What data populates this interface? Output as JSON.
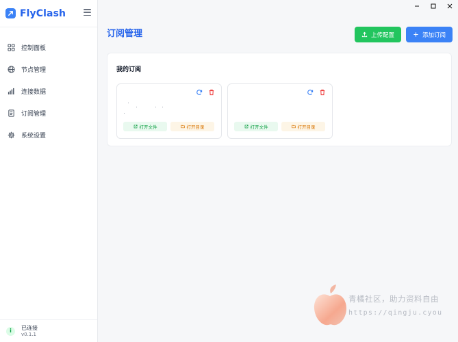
{
  "app": {
    "name": "FlyClash"
  },
  "sidebar": {
    "items": [
      {
        "label": "控制面板",
        "icon": "dashboard-icon"
      },
      {
        "label": "节点管理",
        "icon": "globe-icon"
      },
      {
        "label": "连接数据",
        "icon": "bar-chart-icon"
      },
      {
        "label": "订阅管理",
        "icon": "document-icon"
      },
      {
        "label": "系统设置",
        "icon": "gear-icon"
      }
    ],
    "status": {
      "text": "已连接",
      "version": "v0.1.1",
      "badge": "i"
    }
  },
  "header": {
    "title": "订阅管理",
    "upload_label": "上传配置",
    "add_label": "添加订阅"
  },
  "panel": {
    "title": "我的订阅",
    "cards": [
      {
        "open_file_label": "打开文件",
        "open_dir_label": "打开目录"
      },
      {
        "open_file_label": "打开文件",
        "open_dir_label": "打开目录"
      }
    ]
  },
  "watermark": {
    "line1": "青橘社区，助力资料自由",
    "line2": "https://qingju.cyou"
  },
  "colors": {
    "accent": "#2563eb",
    "upload": "#22c55e",
    "add": "#3b82f6",
    "refresh": "#3b82f6",
    "delete": "#ef4444"
  }
}
